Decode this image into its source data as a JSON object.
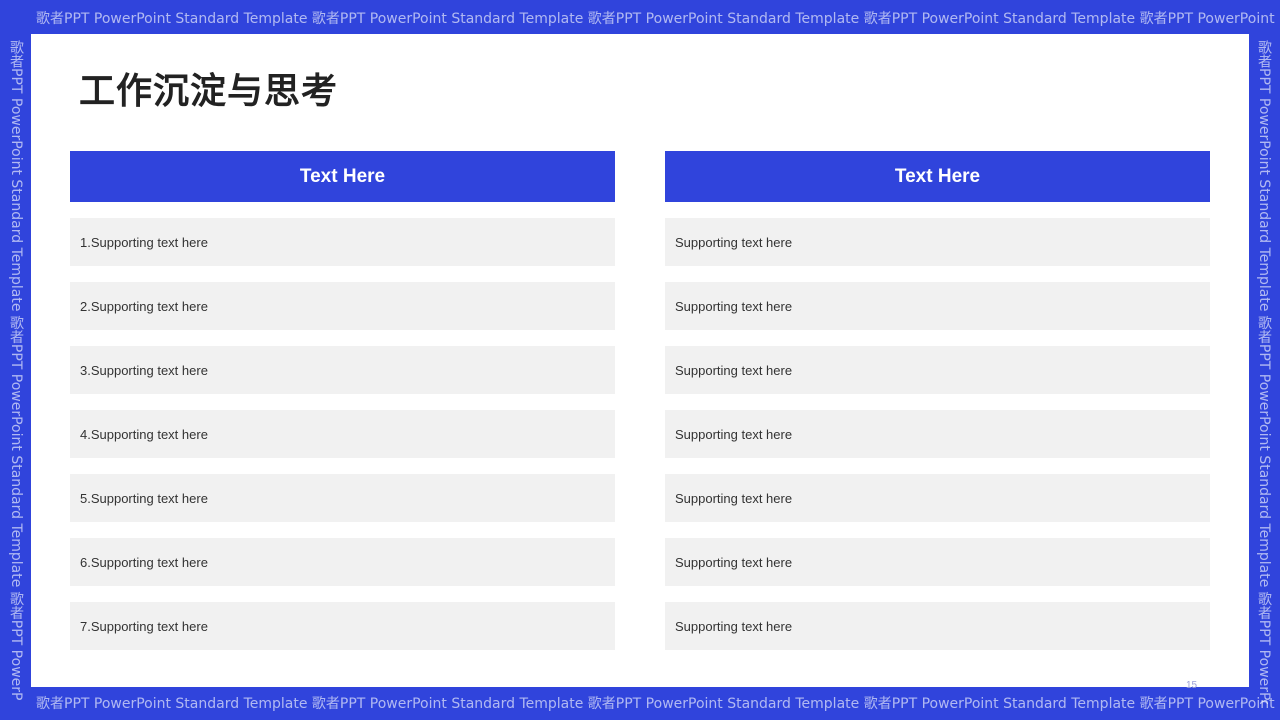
{
  "frame": {
    "top_text": "歌者PPT PowerPoint Standard Template 歌者PPT PowerPoint Standard Template 歌者PPT PowerPoint Standard Template 歌者PPT PowerPoint Standard Template 歌者PPT PowerPoint",
    "bottom_text": "歌者PPT PowerPoint Standard Template 歌者PPT PowerPoint Standard Template 歌者PPT PowerPoint Standard Template 歌者PPT PowerPoint Standard Template 歌者PPT PowerPoint",
    "left_text": "歌者PPT PowerPoint Standard Template 歌者PPT PowerPoint Standard Template 歌者PPT PowerP",
    "right_text": "歌者PPT PowerPoint Standard Template 歌者PPT PowerPoint Standard Template 歌者PPT PowerPoint"
  },
  "slide": {
    "title": "工作沉淀与思考",
    "page_number": "15"
  },
  "columns": [
    {
      "header": "Text Here",
      "rows": [
        "1.Supporting  text here",
        "2.Supporting  text here",
        "3.Supporting  text here",
        "4.Supporting  text here",
        "5.Supporting  text here",
        "6.Supporting  text here",
        "7.Supporting  text here"
      ]
    },
    {
      "header": "Text Here",
      "rows": [
        "Supporting  text here",
        "Supporting  text here",
        "Supporting  text here",
        "Supporting  text here",
        "Supporting  text here",
        "Supporting  text here",
        "Supporting  text here"
      ]
    }
  ],
  "colors": {
    "accent": "#3044dc",
    "row_background": "#f1f1f1"
  }
}
